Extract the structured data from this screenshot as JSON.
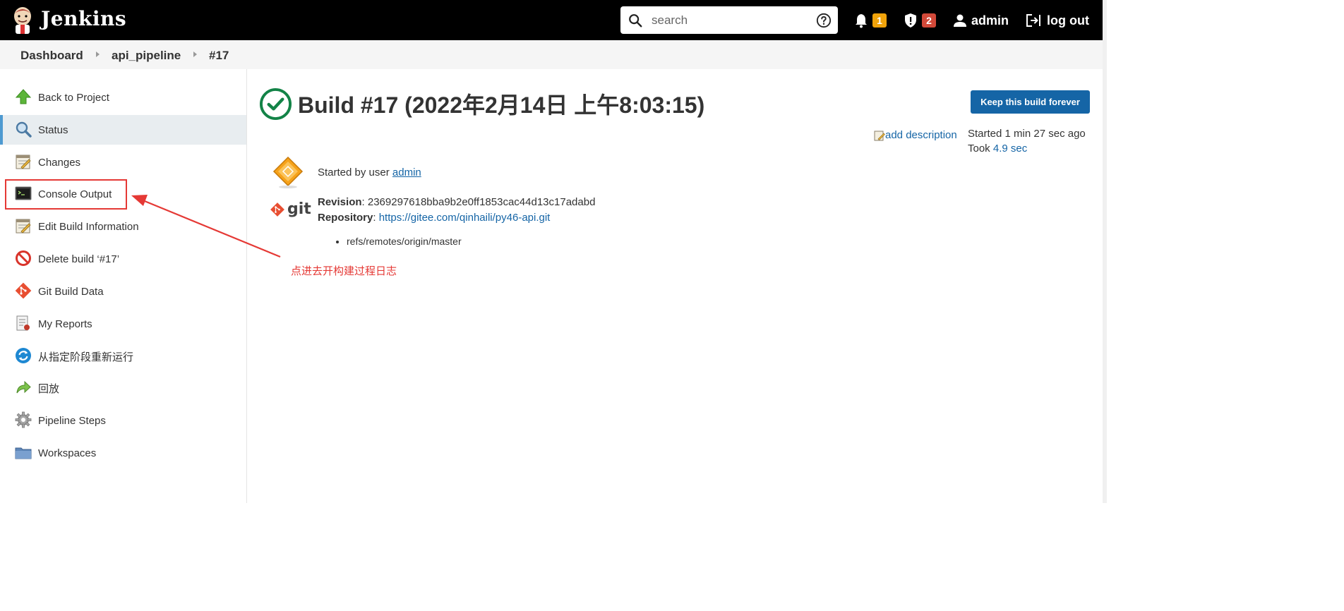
{
  "header": {
    "brand": "Jenkins",
    "search_placeholder": "search",
    "notifications_count": "1",
    "security_count": "2",
    "user": "admin",
    "logout": "log out"
  },
  "breadcrumb": {
    "items": [
      "Dashboard",
      "api_pipeline",
      "#17"
    ]
  },
  "sidebar": {
    "items": [
      {
        "label": "Back to Project",
        "icon": "up-arrow-icon"
      },
      {
        "label": "Status",
        "icon": "magnifier-icon"
      },
      {
        "label": "Changes",
        "icon": "notepad-icon"
      },
      {
        "label": "Console Output",
        "icon": "terminal-icon"
      },
      {
        "label": "Edit Build Information",
        "icon": "notepad-edit-icon"
      },
      {
        "label": "Delete build ‘#17’",
        "icon": "no-entry-icon"
      },
      {
        "label": "Git Build Data",
        "icon": "git-icon"
      },
      {
        "label": "My Reports",
        "icon": "report-icon"
      },
      {
        "label": "从指定阶段重新运行",
        "icon": "refresh-icon"
      },
      {
        "label": "回放",
        "icon": "replay-icon"
      },
      {
        "label": "Pipeline Steps",
        "icon": "gear-icon"
      },
      {
        "label": "Workspaces",
        "icon": "folder-icon"
      }
    ],
    "active_index": 1
  },
  "main": {
    "title": "Build #17 (2022年2月14日 上午8:03:15)",
    "keep_button": "Keep this build forever",
    "add_description": "add description",
    "started_text": "Started 1 min 27 sec ago",
    "took_prefix": "Took ",
    "took_value": "4.9 sec",
    "started_by_prefix": "Started by user ",
    "started_by_user": "admin",
    "git_label": "git",
    "revision_label": "Revision",
    "revision_value": ": 2369297618bba9b2e0ff1853cac44d13c17adabd",
    "repository_label": "Repository",
    "repository_sep": ": ",
    "repository_url": "https://gitee.com/qinhaili/py46-api.git",
    "refs": [
      "refs/remotes/origin/master"
    ]
  },
  "annotation": {
    "text": "点进去开构建过程日志"
  },
  "colors": {
    "accent": "#1565a6",
    "success": "#138347",
    "annotation": "#e53935"
  }
}
